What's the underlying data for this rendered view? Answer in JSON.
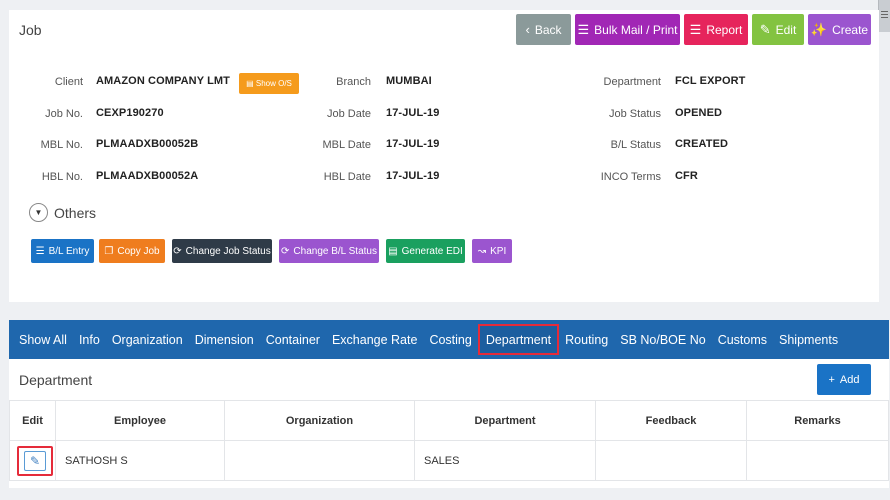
{
  "header": {
    "title": "Job",
    "buttons": {
      "back": "Back",
      "bulk": "Bulk Mail / Print",
      "report": "Report",
      "edit": "Edit",
      "create": "Create"
    }
  },
  "details": {
    "client_label": "Client",
    "client": "AMAZON COMPANY LMT",
    "show_os": "Show O/S",
    "branch_label": "Branch",
    "branch": "MUMBAI",
    "department_label": "Department",
    "department": "FCL EXPORT",
    "jobno_label": "Job No.",
    "jobno": "CEXP190270",
    "jobdate_label": "Job Date",
    "jobdate": "17-JUL-19",
    "jobstatus_label": "Job Status",
    "jobstatus": "OPENED",
    "mblno_label": "MBL No.",
    "mblno": "PLMAADXB00052B",
    "mbldate_label": "MBL Date",
    "mbldate": "17-JUL-19",
    "blstatus_label": "B/L Status",
    "blstatus": "CREATED",
    "hblno_label": "HBL No.",
    "hblno": "PLMAADXB00052A",
    "hbldate_label": "HBL Date",
    "hbldate": "17-JUL-19",
    "inco_label": "INCO Terms",
    "inco": "CFR"
  },
  "others_label": "Others",
  "actions": {
    "bl_entry": "B/L Entry",
    "copy_job": "Copy Job",
    "change_job_status": "Change Job Status",
    "change_bl_status": "Change B/L Status",
    "generate_edi": "Generate EDI",
    "kpi": "KPI"
  },
  "tabs": [
    "Show All",
    "Info",
    "Organization",
    "Dimension",
    "Container",
    "Exchange Rate",
    "Costing",
    "Department",
    "Routing",
    "SB No/BOE No",
    "Customs",
    "Shipments"
  ],
  "active_tab": "Department",
  "section": {
    "title": "Department",
    "add_label": "Add"
  },
  "table": {
    "headers": [
      "Edit",
      "Employee",
      "Organization",
      "Department",
      "Feedback",
      "Remarks"
    ],
    "rows": [
      {
        "employee": "SATHOSH S",
        "organization": "",
        "department": "SALES",
        "feedback": "",
        "remarks": ""
      }
    ]
  },
  "icons": {
    "back": "chevron-left-icon",
    "bulk": "list-icon",
    "report": "list-icon",
    "edit": "edit-icon",
    "create": "magic-wand-icon",
    "add": "plus-icon",
    "others": "caret-down-icon"
  },
  "colors": {
    "tabbar": "#1f67ad",
    "highlight": "#e52b3a"
  }
}
